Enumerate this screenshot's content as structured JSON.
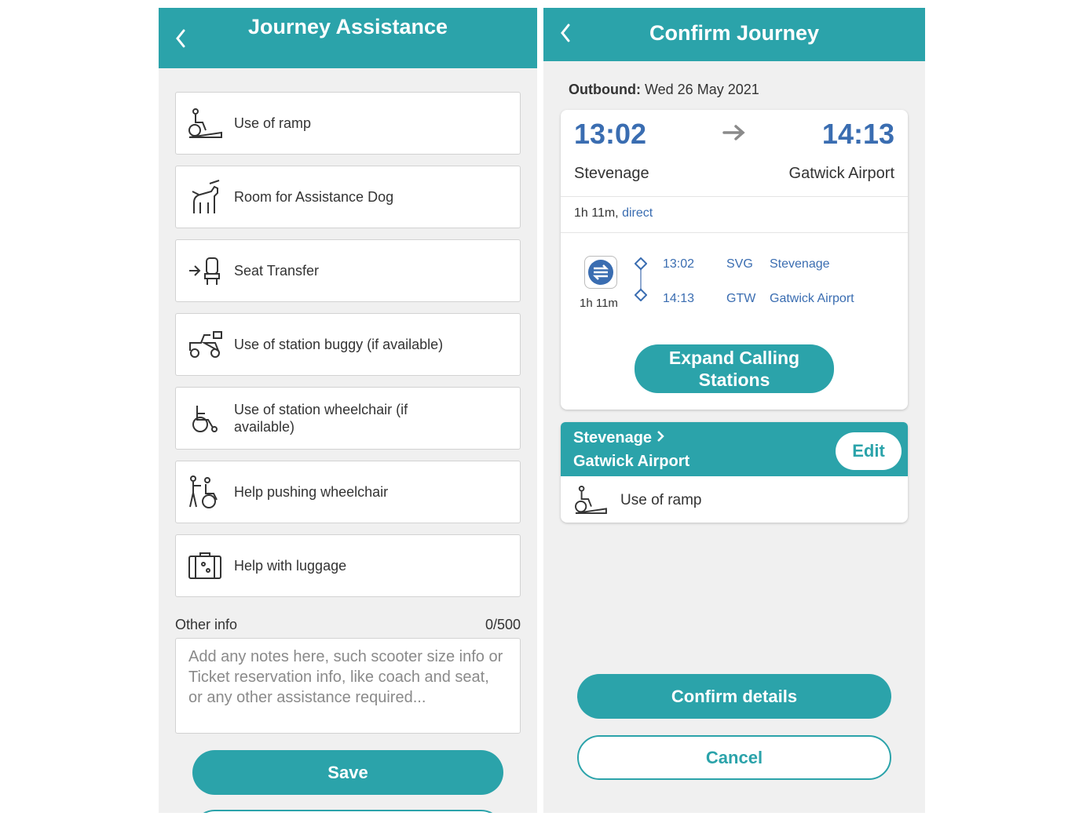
{
  "assistance_screen": {
    "title": "Journey Assistance",
    "options": [
      {
        "label": "Use of ramp",
        "icon": "wheelchair-ramp-icon"
      },
      {
        "label": "Room for Assistance Dog",
        "icon": "assistance-dog-icon"
      },
      {
        "label": "Seat Transfer",
        "icon": "seat-transfer-icon"
      },
      {
        "label": "Use of station buggy (if available)",
        "icon": "buggy-icon"
      },
      {
        "label": "Use of station wheelchair (if available)",
        "icon": "wheelchair-icon"
      },
      {
        "label": "Help pushing wheelchair",
        "icon": "pushing-wheelchair-icon"
      },
      {
        "label": "Help with luggage",
        "icon": "luggage-icon"
      }
    ],
    "other_info_label": "Other info",
    "other_info_count": "0/500",
    "other_info_placeholder": "Add any notes here, such scooter size info or Ticket reservation info, like coach and seat, or any other assistance required...",
    "save_label": "Save"
  },
  "confirm_screen": {
    "title": "Confirm Journey",
    "outbound_label": "Outbound:",
    "outbound_date": "Wed 26 May 2021",
    "depart_time": "13:02",
    "arrive_time": "14:13",
    "origin": "Stevenage",
    "destination": "Gatwick Airport",
    "duration": "1h 11m,",
    "journey_type": "direct",
    "leg": {
      "duration": "1h 11m",
      "stops": [
        {
          "time": "13:02",
          "code": "SVG",
          "name": "Stevenage"
        },
        {
          "time": "14:13",
          "code": "GTW",
          "name": "Gatwick Airport"
        }
      ]
    },
    "expand_label_1": "Expand Calling",
    "expand_label_2": "Stations",
    "summary_from": "Stevenage",
    "summary_to": "Gatwick Airport",
    "edit_label": "Edit",
    "selected_assistance": "Use of ramp",
    "confirm_label": "Confirm details",
    "cancel_label": "Cancel"
  },
  "colors": {
    "brand": "#2ba3aa",
    "time_blue": "#3a6db1",
    "background": "#f0f0f0"
  }
}
